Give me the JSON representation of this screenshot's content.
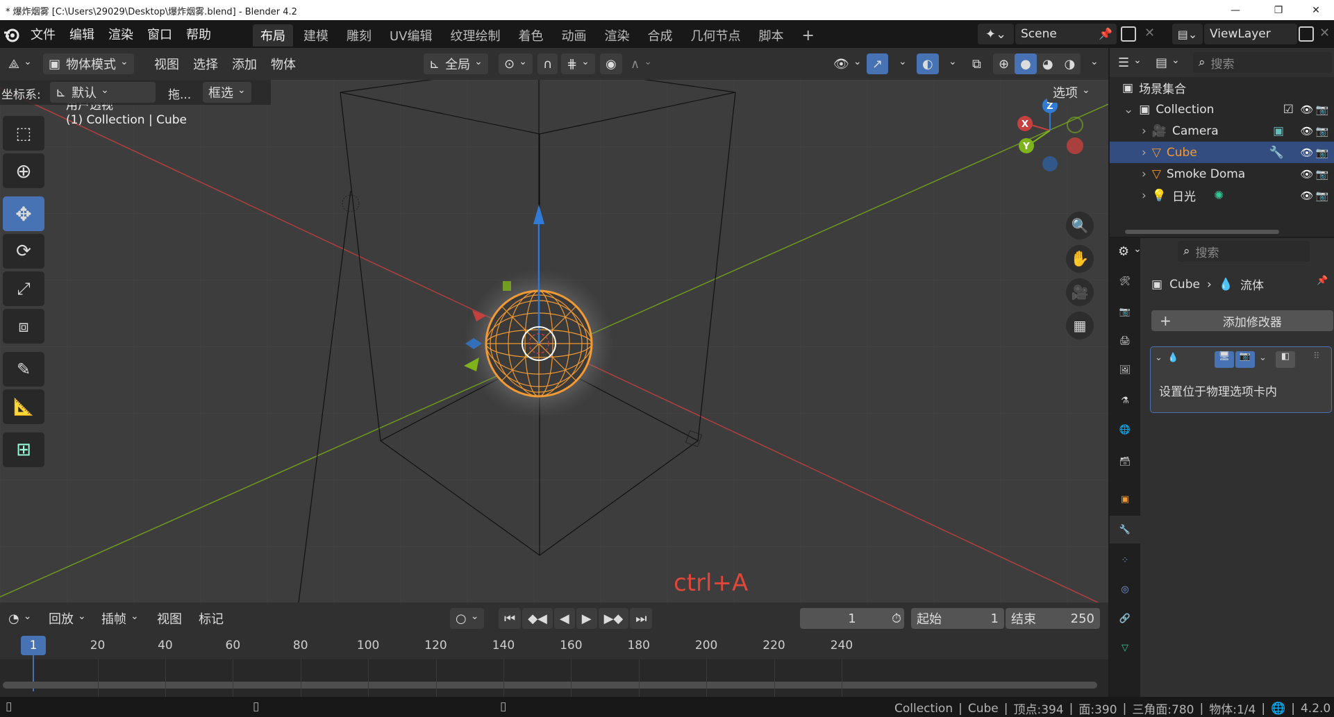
{
  "window": {
    "title": "* 爆炸烟雾 [C:\\Users\\29029\\Desktop\\爆炸烟雾.blend] - Blender 4.2",
    "minimize": "—",
    "maximize": "❐",
    "close": "✕"
  },
  "menu": [
    "文件",
    "编辑",
    "渲染",
    "窗口",
    "帮助"
  ],
  "workspaces": [
    "布局",
    "建模",
    "雕刻",
    "UV编辑",
    "纹理绘制",
    "着色",
    "动画",
    "渲染",
    "合成",
    "几何节点",
    "脚本"
  ],
  "workspace_add": "+",
  "scene": {
    "name": "Scene",
    "view_layer": "ViewLayer"
  },
  "viewport_header": {
    "mode": "物体模式",
    "menus": [
      "视图",
      "选择",
      "添加",
      "物体"
    ],
    "transform_orientation": "全局"
  },
  "viewport_sub": {
    "coord_label": "坐标系:",
    "coord_value": "默认",
    "drag_label": "拖...",
    "select_mode": "框选",
    "options": "选项"
  },
  "viewport_overlay": {
    "view_name": "用户透视",
    "context": "(1) Collection | Cube",
    "hint": "ctrl+A"
  },
  "gizmo": {
    "x": "X",
    "y": "Y",
    "z": "Z"
  },
  "timeline": {
    "playback": "回放",
    "keying": "插帧",
    "view": "视图",
    "marker": "标记",
    "current_frame": "1",
    "start_label": "起始",
    "start": "1",
    "end_label": "结束",
    "end": "250",
    "playhead": "1",
    "ticks": [
      "20",
      "40",
      "60",
      "80",
      "100",
      "120",
      "140",
      "160",
      "180",
      "200",
      "220",
      "240"
    ]
  },
  "outliner": {
    "search_placeholder": "搜索",
    "root": "场景集合",
    "collection": "Collection",
    "items": [
      {
        "name": "Camera"
      },
      {
        "name": "Cube"
      },
      {
        "name": "Smoke Doma"
      },
      {
        "name": "日光"
      }
    ]
  },
  "properties": {
    "search_placeholder": "搜索",
    "breadcrumb_object": "Cube",
    "breadcrumb_section": "流体",
    "add_modifier": "添加修改器",
    "modifier_note": "设置位于物理选项卡内"
  },
  "status": {
    "collection": "Collection",
    "object": "Cube",
    "verts": "顶点:394",
    "faces": "面:390",
    "tris": "三角面:780",
    "objects": "物体:1/4",
    "version": "4.2.0"
  },
  "colors": {
    "accent": "#4772b3",
    "selected_row": "#334d80",
    "object_orange": "#f29a33",
    "axis_x": "#c5413f",
    "axis_y": "#7fb31b",
    "axis_z": "#2f7bd6",
    "hint_red": "#e0473a"
  }
}
